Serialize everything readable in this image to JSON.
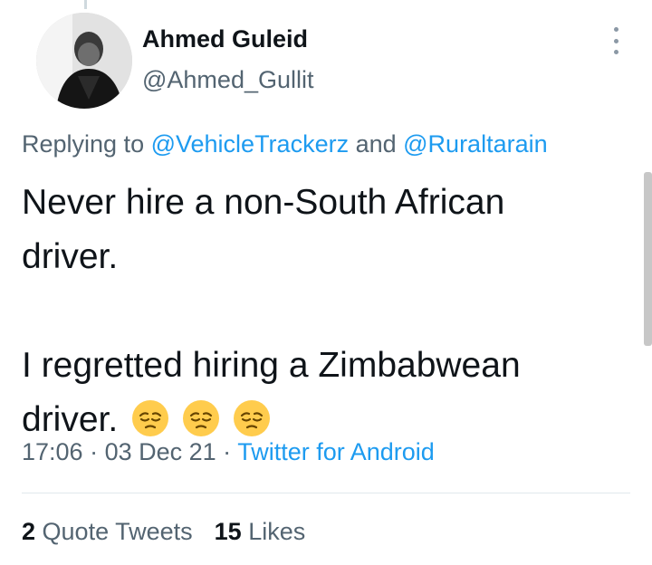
{
  "tweet": {
    "author_name": "Ahmed Guleid",
    "author_handle": "@Ahmed_Gullit",
    "replying_prefix": "Replying to ",
    "reply_to_1": "@VehicleTrackerz",
    "reply_joiner": " and ",
    "reply_to_2": "@Ruraltarain",
    "text_line_1": "Never hire a non-South African",
    "text_line_2": "driver.",
    "text_line_3": "I regretted hiring a Zimbabwean",
    "text_line_4": "driver.",
    "emojis": [
      "pensive-face-emoji",
      "pensive-face-emoji",
      "pensive-face-emoji"
    ],
    "time": "17:06",
    "separator": " · ",
    "date": "03 Dec 21",
    "source": "Twitter for Android"
  },
  "stats": {
    "quote_count": "2",
    "quote_label": " Quote Tweets",
    "like_count": "15",
    "like_label": " Likes"
  },
  "colors": {
    "link": "#1d9bf0",
    "secondary_text": "#536471",
    "primary_text": "#0f1419"
  }
}
